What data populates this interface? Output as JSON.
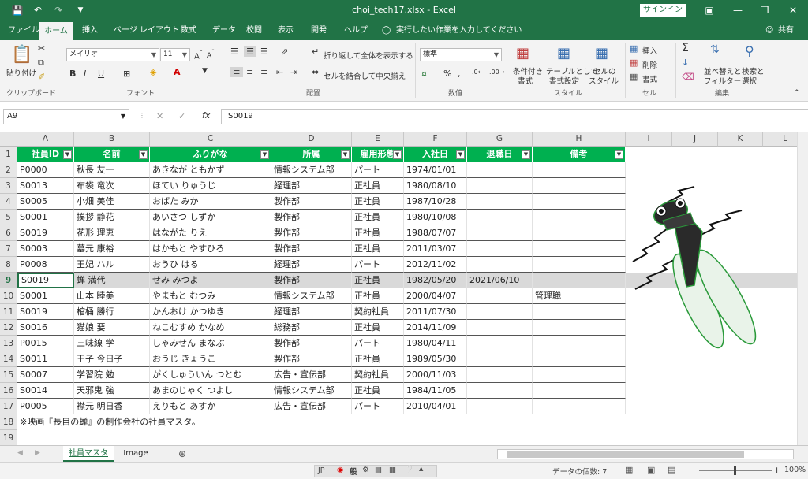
{
  "window": {
    "title": "choi_tech17.xlsx  -  Excel",
    "signin": "サインイン",
    "share": "共有"
  },
  "tabs": [
    "ファイル",
    "ホーム",
    "挿入",
    "ページ レイアウト",
    "数式",
    "データ",
    "校閲",
    "表示",
    "開発",
    "ヘルプ"
  ],
  "tell_me": "実行したい作業を入力してください",
  "ribbon": {
    "paste": "貼り付け",
    "clipboard": "クリップボード",
    "font_name": "メイリオ",
    "font_size": "11",
    "font_group": "フォント",
    "wrap": "折り返して全体を表示する",
    "merge": "セルを結合して中央揃え",
    "align_group": "配置",
    "number_format": "標準",
    "number_group": "数値",
    "cond": "条件付き\n書式",
    "cond1": "条件付き",
    "cond2": "書式",
    "table1": "テーブルとして",
    "table2": "書式設定",
    "cellstyle1": "セルの",
    "cellstyle2": "スタイル",
    "style_group": "スタイル",
    "insert": "挿入",
    "delete": "削除",
    "format": "書式",
    "cells_group": "セル",
    "sort1": "並べ替えと",
    "sort2": "フィルター",
    "find1": "検索と",
    "find2": "選択",
    "edit_group": "編集"
  },
  "formula": {
    "namebox": "A9",
    "value": "S0019"
  },
  "columns": [
    "A",
    "B",
    "C",
    "D",
    "E",
    "F",
    "G",
    "H",
    "I",
    "J",
    "K",
    "L"
  ],
  "table_headers": [
    "社員ID",
    "名前",
    "ふりがな",
    "所属",
    "雇用形態",
    "入社日",
    "退職日",
    "備考"
  ],
  "rows": [
    [
      "P0000",
      "秋長 友一",
      "あきなが ともかず",
      "情報システム部",
      "パート",
      "1974/01/01",
      "",
      ""
    ],
    [
      "S0013",
      "布袋 竜次",
      "ほてい りゅうじ",
      "経理部",
      "正社員",
      "1980/08/10",
      "",
      ""
    ],
    [
      "S0005",
      "小畑 美佳",
      "おばた みか",
      "製作部",
      "正社員",
      "1987/10/28",
      "",
      ""
    ],
    [
      "S0001",
      "挨拶 静花",
      "あいさつ しずか",
      "製作部",
      "正社員",
      "1980/10/08",
      "",
      ""
    ],
    [
      "S0019",
      "花形 理恵",
      "はながた りえ",
      "製作部",
      "正社員",
      "1988/07/07",
      "",
      ""
    ],
    [
      "S0003",
      "墓元 康裕",
      "はかもと やすひろ",
      "製作部",
      "正社員",
      "2011/03/07",
      "",
      ""
    ],
    [
      "P0008",
      "王妃 ハル",
      "おうひ はる",
      "経理部",
      "パート",
      "2012/11/02",
      "",
      ""
    ],
    [
      "S0019",
      "蝉 満代",
      "せみ みつよ",
      "製作部",
      "正社員",
      "1982/05/20",
      "2021/06/10",
      ""
    ],
    [
      "S0001",
      "山本 睦美",
      "やまもと むつみ",
      "情報システム部",
      "正社員",
      "2000/04/07",
      "",
      "管理職"
    ],
    [
      "S0019",
      "棺桶 勝行",
      "かんおけ かつゆき",
      "経理部",
      "契約社員",
      "2011/07/30",
      "",
      ""
    ],
    [
      "S0016",
      "猫娘 要",
      "ねこむすめ かなめ",
      "総務部",
      "正社員",
      "2014/11/09",
      "",
      ""
    ],
    [
      "P0015",
      "三味線 学",
      "しゃみせん まなぶ",
      "製作部",
      "パート",
      "1980/04/11",
      "",
      ""
    ],
    [
      "S0011",
      "王子 今日子",
      "おうじ きょうこ",
      "製作部",
      "正社員",
      "1989/05/30",
      "",
      ""
    ],
    [
      "S0007",
      "学習院 勉",
      "がくしゅういん つとむ",
      "広告・宣伝部",
      "契約社員",
      "2000/11/03",
      "",
      ""
    ],
    [
      "S0014",
      "天邪鬼 強",
      "あまのじゃく つよし",
      "情報システム部",
      "正社員",
      "1984/11/05",
      "",
      ""
    ],
    [
      "P0005",
      "襟元 明日香",
      "えりもと あすか",
      "広告・宣伝部",
      "パート",
      "2010/04/01",
      "",
      ""
    ]
  ],
  "row_numbers": [
    "1",
    "2",
    "3",
    "4",
    "5",
    "6",
    "7",
    "8",
    "9",
    "10",
    "11",
    "12",
    "13",
    "14",
    "15",
    "16",
    "17",
    "18",
    "19"
  ],
  "note": "※映画『長目の蝉』の制作会社の社員マスタ。",
  "sheets": [
    "社員マスタ",
    "Image"
  ],
  "status": {
    "count": "データの個数: 7",
    "zoom": "100%",
    "ime": "JP",
    "ime_mode": "般"
  }
}
